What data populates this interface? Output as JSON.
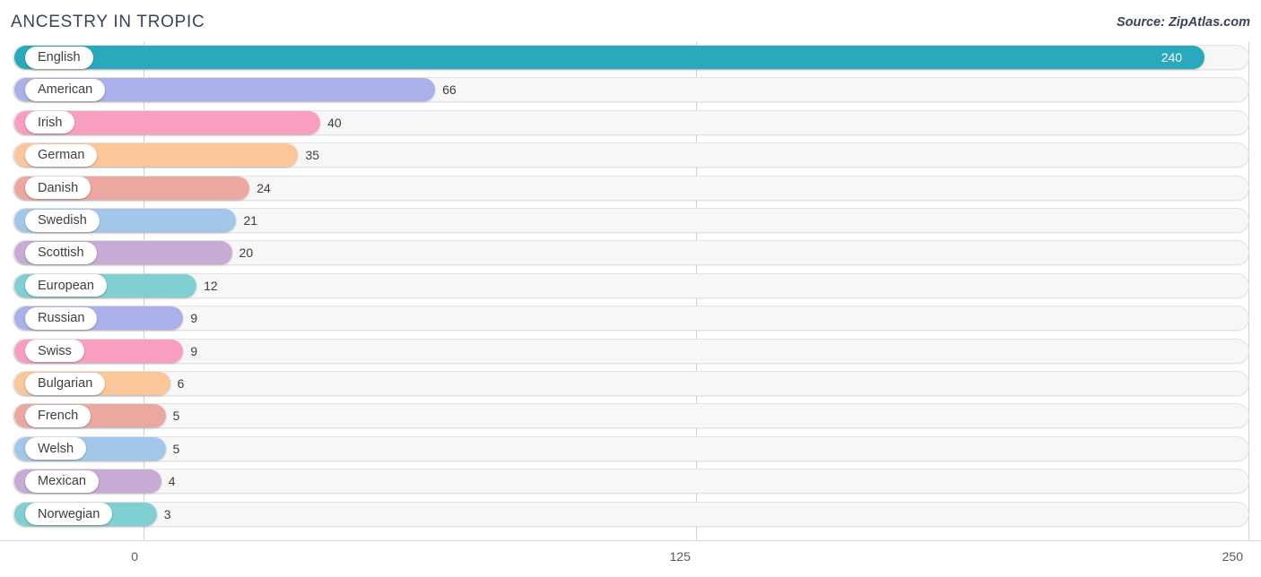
{
  "header": {
    "title": "ANCESTRY IN TROPIC",
    "source": "Source: ZipAtlas.com"
  },
  "axis": {
    "ticks": [
      "0",
      "125",
      "250"
    ]
  },
  "chart_data": {
    "type": "bar",
    "orientation": "horizontal",
    "title": "ANCESTRY IN TROPIC",
    "subtitle": "",
    "xlabel": "",
    "ylabel": "",
    "xlim": [
      0,
      250
    ],
    "xticks": [
      0,
      125,
      250
    ],
    "grid": true,
    "legend": false,
    "source": "Source: ZipAtlas.com",
    "categories": [
      "English",
      "American",
      "Irish",
      "German",
      "Danish",
      "Swedish",
      "Scottish",
      "European",
      "Russian",
      "Swiss",
      "Bulgarian",
      "French",
      "Welsh",
      "Mexican",
      "Norwegian"
    ],
    "values": [
      240,
      66,
      40,
      35,
      24,
      21,
      20,
      12,
      9,
      9,
      6,
      5,
      5,
      4,
      3
    ],
    "value_labels": [
      "240",
      "66",
      "40",
      "35",
      "24",
      "21",
      "20",
      "12",
      "9",
      "9",
      "6",
      "5",
      "5",
      "4",
      "3"
    ],
    "colors": [
      "#2aa9bd",
      "#aab0e8",
      "#f99ec0",
      "#fac69a",
      "#eca7a0",
      "#a3c7ea",
      "#c6abd4",
      "#7fcfd3",
      "#aab0e8",
      "#f99ec0",
      "#fac69a",
      "#eca7a0",
      "#a3c7ea",
      "#c6abd4",
      "#7fcfd3"
    ],
    "bars": [
      {
        "label": "English",
        "value": 240,
        "value_label": "240",
        "color": "#2aa9bd",
        "label_inside": true
      },
      {
        "label": "American",
        "value": 66,
        "value_label": "66",
        "color": "#aab0e8",
        "label_inside": false
      },
      {
        "label": "Irish",
        "value": 40,
        "value_label": "40",
        "color": "#f99ec0",
        "label_inside": false
      },
      {
        "label": "German",
        "value": 35,
        "value_label": "35",
        "color": "#fac69a",
        "label_inside": false
      },
      {
        "label": "Danish",
        "value": 24,
        "value_label": "24",
        "color": "#eca7a0",
        "label_inside": false
      },
      {
        "label": "Swedish",
        "value": 21,
        "value_label": "21",
        "color": "#a3c7ea",
        "label_inside": false
      },
      {
        "label": "Scottish",
        "value": 20,
        "value_label": "20",
        "color": "#c6abd4",
        "label_inside": false
      },
      {
        "label": "European",
        "value": 12,
        "value_label": "12",
        "color": "#7fcfd3",
        "label_inside": false
      },
      {
        "label": "Russian",
        "value": 9,
        "value_label": "9",
        "color": "#aab0e8",
        "label_inside": false
      },
      {
        "label": "Swiss",
        "value": 9,
        "value_label": "9",
        "color": "#f99ec0",
        "label_inside": false
      },
      {
        "label": "Bulgarian",
        "value": 6,
        "value_label": "6",
        "color": "#fac69a",
        "label_inside": false
      },
      {
        "label": "French",
        "value": 5,
        "value_label": "5",
        "color": "#eca7a0",
        "label_inside": false
      },
      {
        "label": "Welsh",
        "value": 5,
        "value_label": "5",
        "color": "#a3c7ea",
        "label_inside": false
      },
      {
        "label": "Mexican",
        "value": 4,
        "value_label": "4",
        "color": "#c6abd4",
        "label_inside": false
      },
      {
        "label": "Norwegian",
        "value": 3,
        "value_label": "3",
        "color": "#7fcfd3",
        "label_inside": false
      }
    ]
  }
}
